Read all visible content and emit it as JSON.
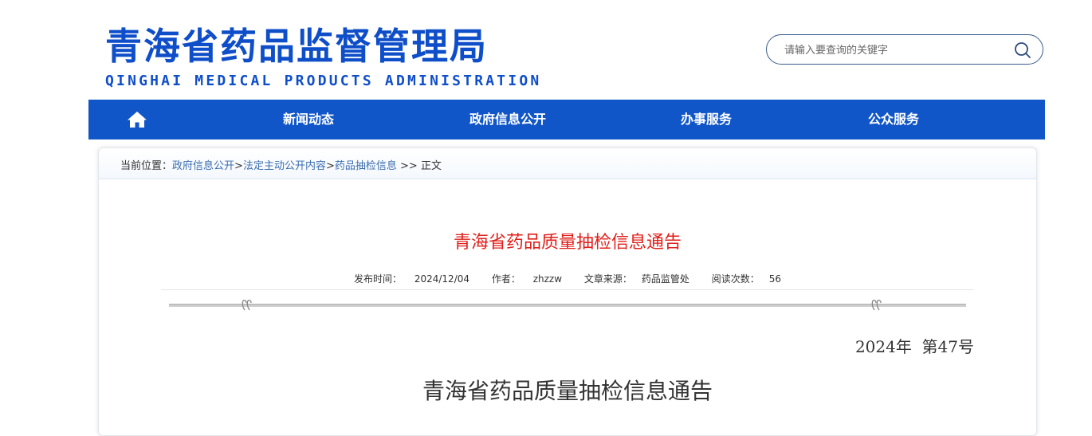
{
  "header": {
    "title": "青海省药品监督管理局",
    "subtitle": "QINGHAI MEDICAL PRODUCTS ADMINISTRATION"
  },
  "search": {
    "placeholder": "请输入要查询的关键字",
    "icon": "search-icon"
  },
  "nav": {
    "home_icon": "home-icon",
    "items": [
      "新闻动态",
      "政府信息公开",
      "办事服务",
      "公众服务"
    ]
  },
  "breadcrumb": {
    "prefix": "当前位置：",
    "links": [
      "政府信息公开",
      "法定主动公开内容",
      "药品抽检信息"
    ],
    "sep": ">",
    "tail_sep": " >> ",
    "current": "正文"
  },
  "article": {
    "title": "青海省药品质量抽检信息通告",
    "meta": {
      "publish_label": "发布时间：",
      "publish_date": "2024/12/04",
      "author_label": "作者：",
      "author": "zhzzw",
      "source_label": "文章来源：",
      "source": "药品监管处",
      "reads_label": "阅读次数：",
      "reads": "56"
    },
    "issue_no": "2024年  第47号",
    "doc_title": "青海省药品质量抽检信息通告"
  },
  "colors": {
    "brand_blue": "#0f4ec9",
    "nav_blue": "#1156c8",
    "title_red": "#e0201b",
    "link_blue": "#3a6db0"
  }
}
